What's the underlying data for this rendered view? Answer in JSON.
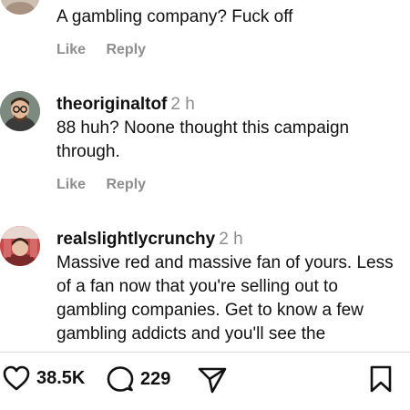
{
  "comments": [
    {
      "username": "",
      "time": "",
      "text": "A gambling company? Fuck off",
      "like_label": "Like",
      "reply_label": "Reply"
    },
    {
      "username": "theoriginaltof",
      "time": "2 h",
      "text": "88 huh? Noone thought this campaign through.",
      "like_label": "Like",
      "reply_label": "Reply"
    },
    {
      "username": "realslightlycrunchy",
      "time": "2 h",
      "text": "Massive red and massive fan of yours. Less of a fan now that you're selling out to gambling companies. Get to know a few gambling addicts and you'll see the",
      "like_label": "",
      "reply_label": ""
    }
  ],
  "bottom_bar": {
    "likes_count": "38.5K",
    "comments_count": "229",
    "icons": [
      "heart-icon",
      "comment-icon",
      "share-icon",
      "bookmark-icon"
    ]
  },
  "colors": {
    "text": "#111111",
    "muted": "#8e8e8e",
    "divider": "#dbdbdb"
  }
}
